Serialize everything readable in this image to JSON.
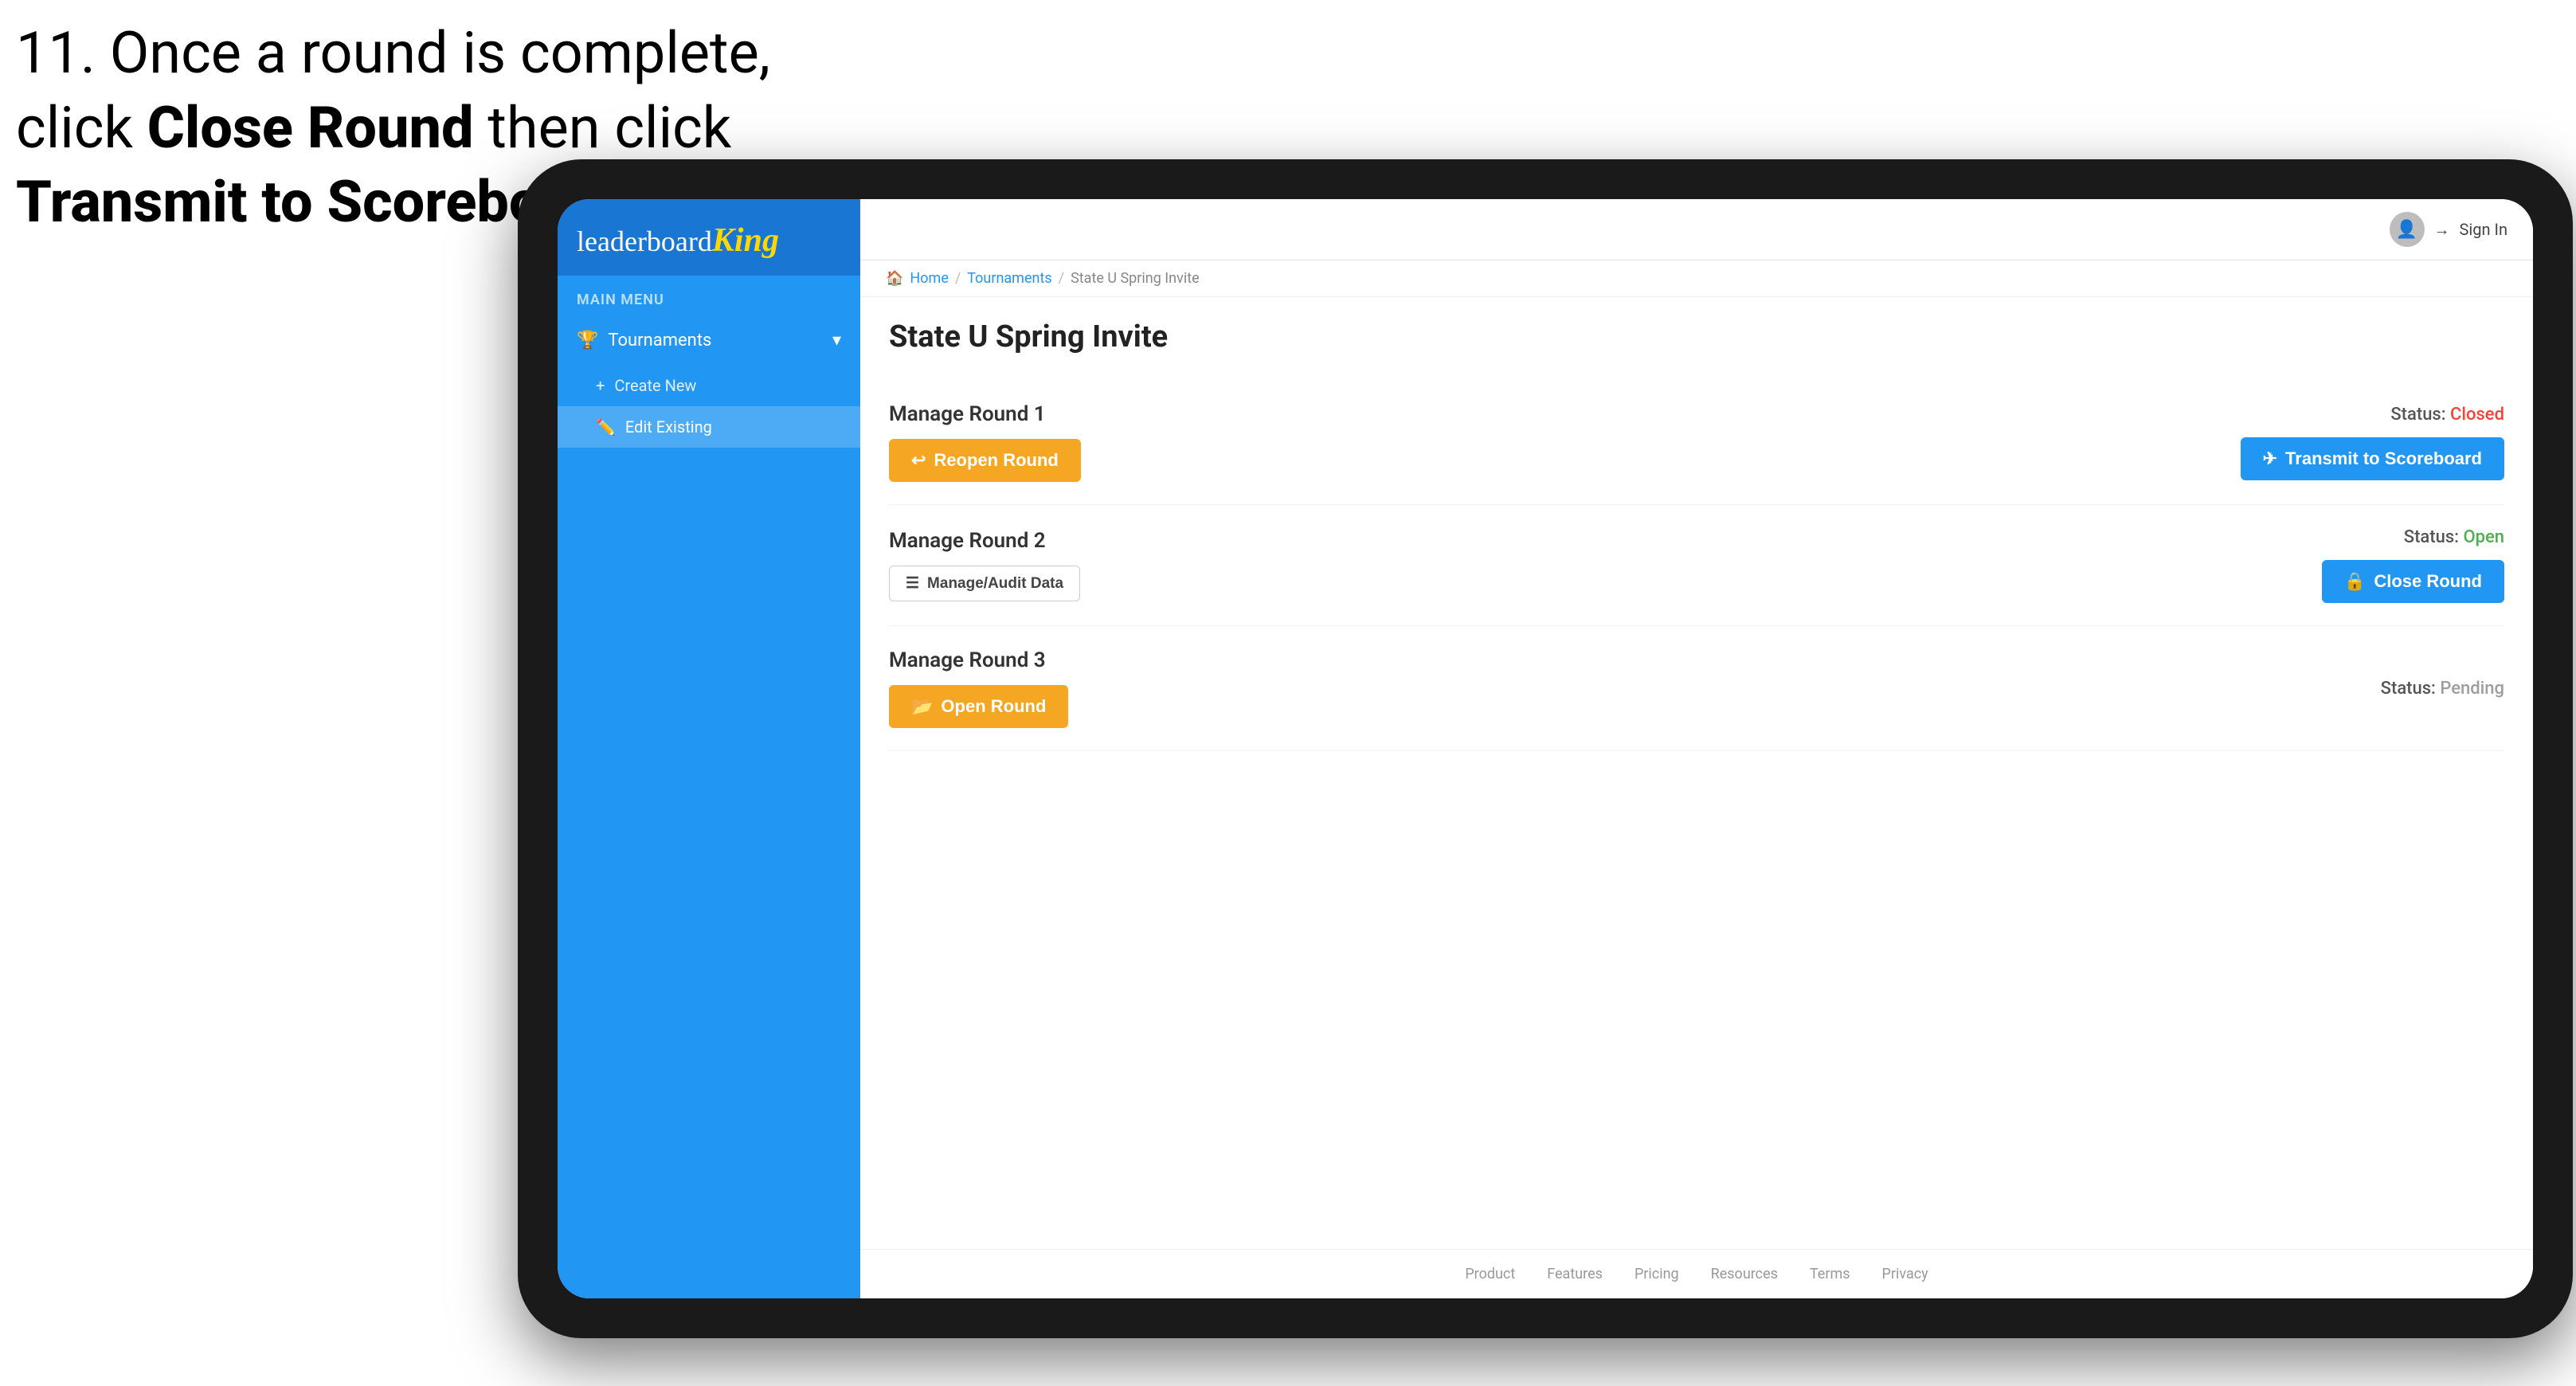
{
  "instruction": {
    "line1": "11. Once a round is complete,",
    "line2": "click ",
    "bold1": "Close Round",
    "line3": " then click",
    "bold2": "Transmit to Scoreboard."
  },
  "app": {
    "logo": {
      "leaderboard": "leaderboard",
      "king": "King"
    },
    "header": {
      "signin_label": "Sign In"
    },
    "sidebar": {
      "main_menu_label": "MAIN MENU",
      "tournaments_label": "Tournaments",
      "create_new_label": "Create New",
      "edit_existing_label": "Edit Existing"
    },
    "breadcrumb": {
      "home": "Home",
      "sep1": "/",
      "tournaments": "Tournaments",
      "sep2": "/",
      "current": "State U Spring Invite"
    },
    "page_title": "State U Spring Invite",
    "rounds": [
      {
        "id": "round1",
        "title": "Manage Round 1",
        "status_label": "Status:",
        "status_value": "Closed",
        "status_class": "status-closed",
        "primary_button": {
          "label": "Reopen Round",
          "icon": "↩",
          "style": "btn-amber"
        },
        "secondary_button": {
          "label": "Transmit to Scoreboard",
          "icon": "✈",
          "style": "btn-blue"
        }
      },
      {
        "id": "round2",
        "title": "Manage Round 2",
        "status_label": "Status:",
        "status_value": "Open",
        "status_class": "status-open",
        "primary_button": {
          "label": "Manage/Audit Data",
          "icon": "☰",
          "style": "btn-small"
        },
        "secondary_button": {
          "label": "Close Round",
          "icon": "🔒",
          "style": "btn-blue"
        }
      },
      {
        "id": "round3",
        "title": "Manage Round 3",
        "status_label": "Status:",
        "status_value": "Pending",
        "status_class": "status-pending",
        "primary_button": {
          "label": "Open Round",
          "icon": "📂",
          "style": "btn-amber"
        },
        "secondary_button": null
      }
    ],
    "footer": {
      "links": [
        "Product",
        "Features",
        "Pricing",
        "Resources",
        "Terms",
        "Privacy"
      ]
    }
  },
  "colors": {
    "accent_blue": "#2196f3",
    "accent_amber": "#f5a623",
    "status_closed": "#f44336",
    "status_open": "#4caf50",
    "status_pending": "#9e9e9e"
  }
}
